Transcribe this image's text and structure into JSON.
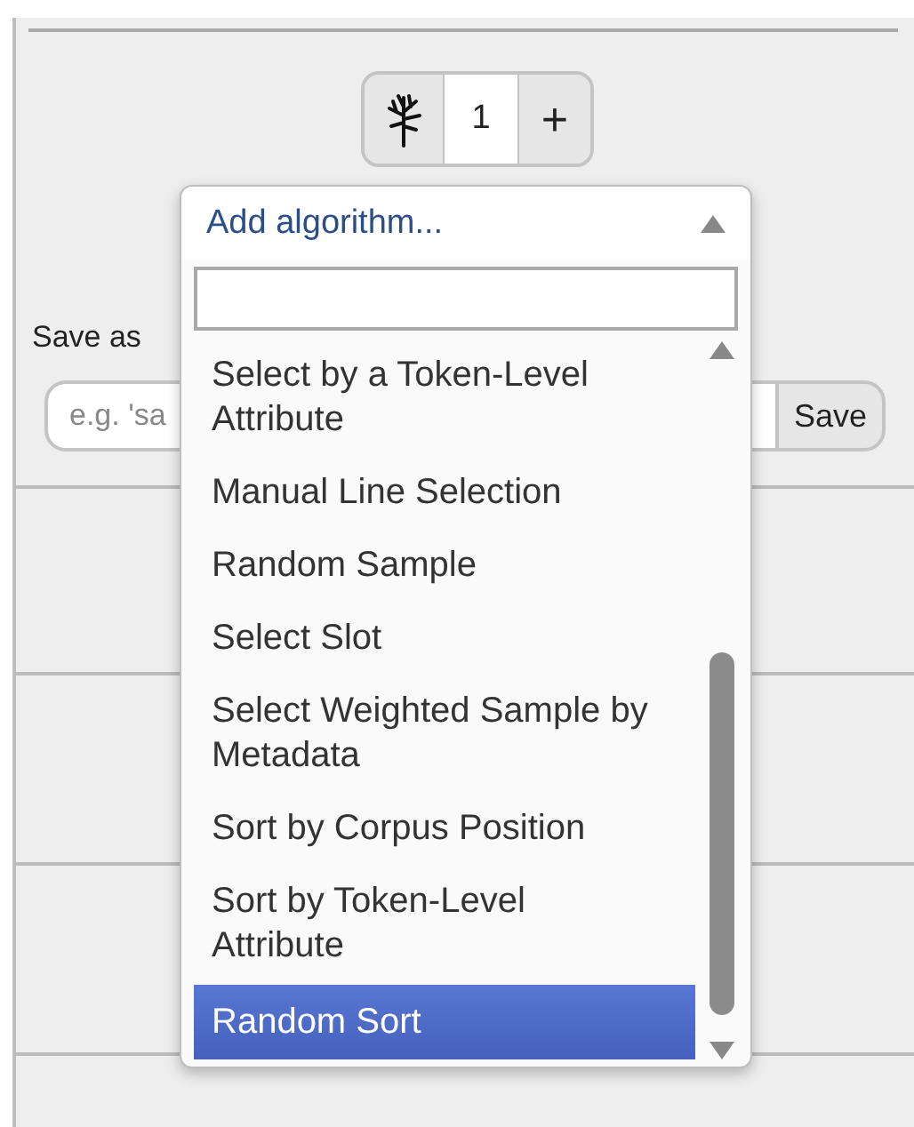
{
  "counter": {
    "value": "1",
    "add_label": "+"
  },
  "save": {
    "label": "Save as",
    "placeholder": "e.g. 'sa",
    "button": "Save"
  },
  "dropdown": {
    "title": "Add algorithm...",
    "expanded": true,
    "options": [
      {
        "label": "Select by a Token-Level Attribute",
        "selected": false
      },
      {
        "label": "Manual Line Selection",
        "selected": false
      },
      {
        "label": "Random Sample",
        "selected": false
      },
      {
        "label": "Select Slot",
        "selected": false
      },
      {
        "label": "Select Weighted Sample by Metadata",
        "selected": false
      },
      {
        "label": "Sort by Corpus Position",
        "selected": false
      },
      {
        "label": "Sort by Token-Level Attribute",
        "selected": false
      },
      {
        "label": "Random Sort",
        "selected": true
      }
    ]
  }
}
